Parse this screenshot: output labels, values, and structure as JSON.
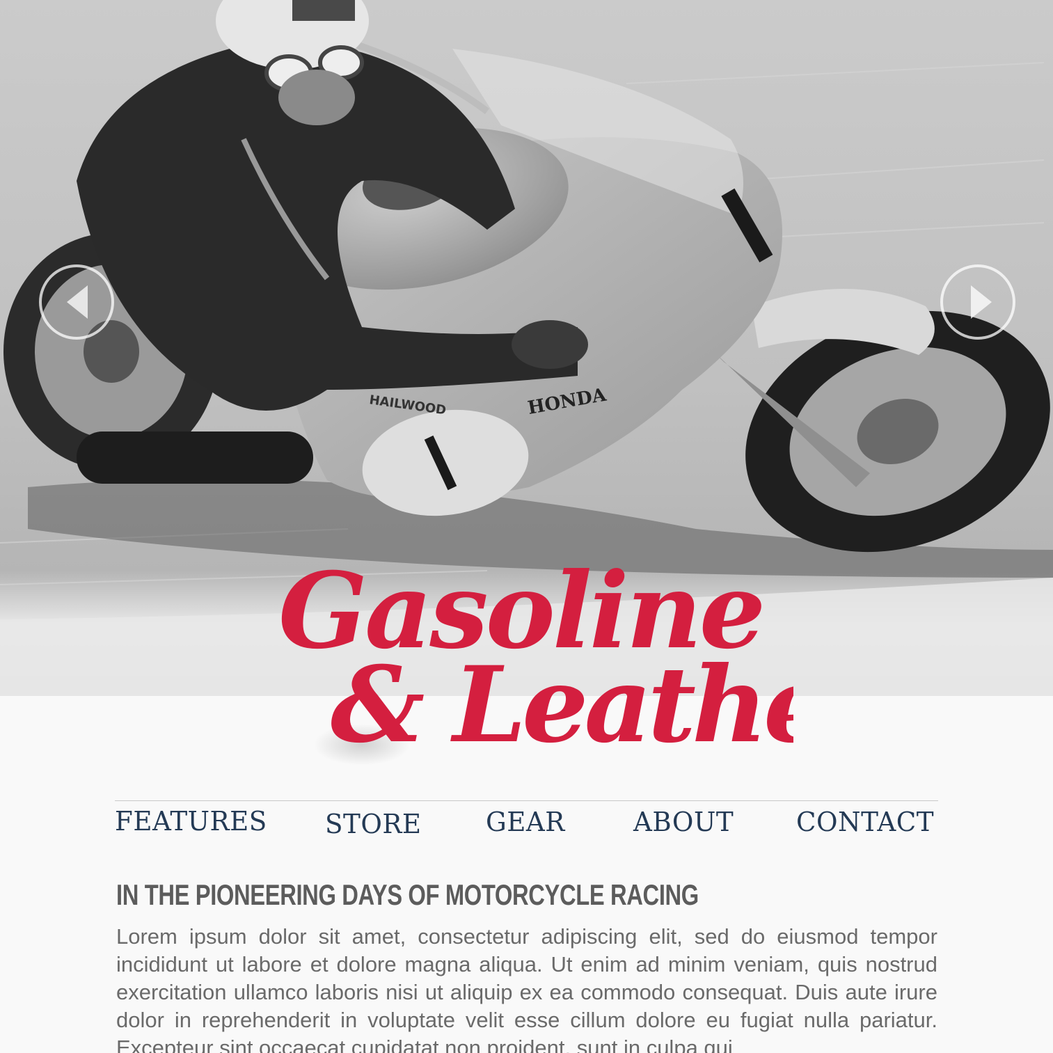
{
  "hero": {
    "prev_icon": "chevron-left-icon",
    "next_icon": "chevron-right-icon",
    "rider_number": "1",
    "rider_name": "HAILWOOD",
    "bike_brand": "HONDA"
  },
  "brand": {
    "line1": "Gasoline",
    "line2": "& Leather",
    "color": "#d41f3f"
  },
  "nav": {
    "items": [
      {
        "label": "FEATURES"
      },
      {
        "label": "STORE"
      },
      {
        "label": "GEAR"
      },
      {
        "label": "ABOUT"
      },
      {
        "label": "CONTACT"
      }
    ],
    "color": "#243a55"
  },
  "article": {
    "headline": "IN THE PIONEERING DAYS OF MOTORCYCLE RACING",
    "body": "Lorem ipsum dolor sit amet, consectetur adipiscing elit, sed do eiusmod tempor incididunt ut labore et dolore magna aliqua. Ut enim ad minim veniam, quis nos­trud exercitation ullamco laboris nisi ut aliquip ex ea commodo consequat. Duis aute irure dolor in reprehenderit in voluptate velit esse cillum dolore eu fugiat nulla pariatur. Excepteur sint occaecat cupidatat non proident, sunt in culpa qui"
  }
}
